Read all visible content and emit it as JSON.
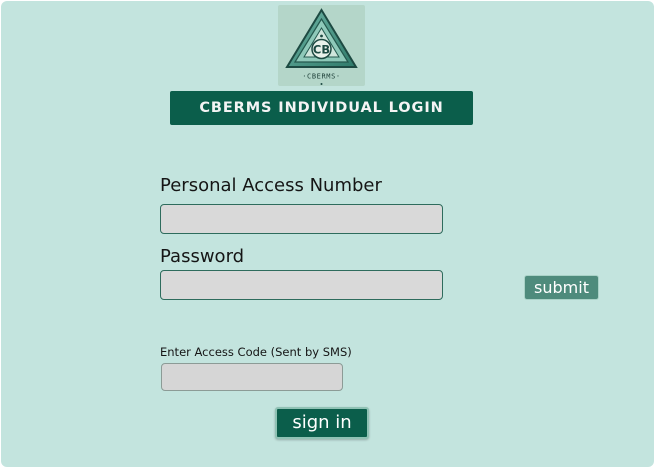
{
  "colors": {
    "background": "#c3e4de",
    "accent": "#0b5e4b",
    "submit_bg": "#4e8b7c",
    "input_bg": "#d9d9d9"
  },
  "logo": {
    "icon": "triangle-logo-icon",
    "monogram": "CB",
    "wordmark": "·CBERMS·"
  },
  "header": {
    "title": "CBERMS INDIVIDUAL LOGIN"
  },
  "form": {
    "pan": {
      "label": "Personal Access Number",
      "value": ""
    },
    "password": {
      "label": "Password",
      "value": ""
    },
    "submit_label": "submit",
    "access_code": {
      "label": "Enter Access Code (Sent by SMS)",
      "value": ""
    },
    "sign_in_label": "sign in"
  }
}
